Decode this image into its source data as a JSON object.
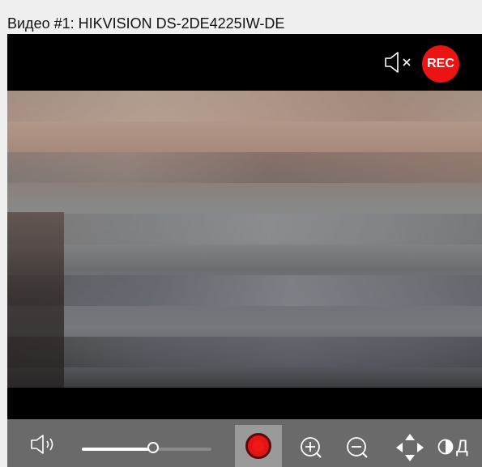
{
  "window": {
    "title": "Видео #1: HIKVISION DS-2DE4225IW-DE"
  },
  "overlay": {
    "rec_label": "REC",
    "audio_state": "muted"
  },
  "toolbar": {
    "volume_level": 0.55,
    "record_active": true,
    "contrast_label": "Д",
    "icons": [
      "volume-icon",
      "record-icon",
      "zoom-in-icon",
      "zoom-out-icon",
      "pan-icon",
      "contrast-icon"
    ]
  },
  "colors": {
    "rec": "#ee1313",
    "toolbar": "#6a6a6a",
    "video_bg": "#000000"
  }
}
